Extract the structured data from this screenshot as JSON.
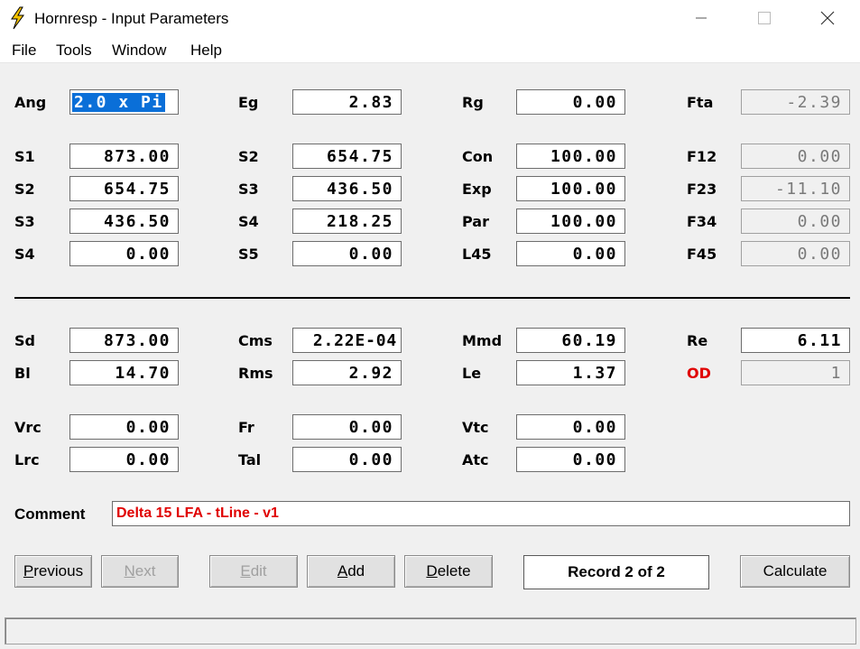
{
  "window": {
    "title": "Hornresp - Input Parameters"
  },
  "menu": [
    "File",
    "Tools",
    "Window",
    "Help"
  ],
  "params": {
    "row1": [
      {
        "label": "Ang",
        "value": "2.0 x Pi"
      },
      {
        "label": "Eg",
        "value": "2.83"
      },
      {
        "label": "Rg",
        "value": "0.00"
      },
      {
        "label": "Fta",
        "value": "-2.39"
      }
    ],
    "row2": [
      {
        "label": "S1",
        "value": "873.00"
      },
      {
        "label": "S2",
        "value": "654.75"
      },
      {
        "label": "Con",
        "value": "100.00"
      },
      {
        "label": "F12",
        "value": "0.00"
      }
    ],
    "row3": [
      {
        "label": "S2",
        "value": "654.75"
      },
      {
        "label": "S3",
        "value": "436.50"
      },
      {
        "label": "Exp",
        "value": "100.00"
      },
      {
        "label": "F23",
        "value": "-11.10"
      }
    ],
    "row4": [
      {
        "label": "S3",
        "value": "436.50"
      },
      {
        "label": "S4",
        "value": "218.25"
      },
      {
        "label": "Par",
        "value": "100.00"
      },
      {
        "label": "F34",
        "value": "0.00"
      }
    ],
    "row5": [
      {
        "label": "S4",
        "value": "0.00"
      },
      {
        "label": "S5",
        "value": "0.00"
      },
      {
        "label": "L45",
        "value": "0.00"
      },
      {
        "label": "F45",
        "value": "0.00"
      }
    ]
  },
  "driver": {
    "row1": [
      {
        "label": "Sd",
        "value": "873.00"
      },
      {
        "label": "Cms",
        "value": "2.22E-04"
      },
      {
        "label": "Mmd",
        "value": "60.19"
      },
      {
        "label": "Re",
        "value": "6.11"
      }
    ],
    "row2": [
      {
        "label": "Bl",
        "value": "14.70"
      },
      {
        "label": "Rms",
        "value": "2.92"
      },
      {
        "label": "Le",
        "value": "1.37"
      },
      {
        "label": "OD",
        "value": "1"
      }
    ],
    "row3": [
      {
        "label": "Vrc",
        "value": "0.00"
      },
      {
        "label": "Fr",
        "value": "0.00"
      },
      {
        "label": "Vtc",
        "value": "0.00"
      }
    ],
    "row4": [
      {
        "label": "Lrc",
        "value": "0.00"
      },
      {
        "label": "Tal",
        "value": "0.00"
      },
      {
        "label": "Atc",
        "value": "0.00"
      }
    ]
  },
  "comment": {
    "label": "Comment",
    "value": "Delta 15 LFA - tLine - v1"
  },
  "buttons": {
    "previous": {
      "accel": "P",
      "rest": "revious"
    },
    "next": {
      "accel": "N",
      "rest": "ext"
    },
    "edit": {
      "accel": "E",
      "rest": "dit"
    },
    "add": {
      "accel": "A",
      "rest": "dd"
    },
    "delete": {
      "accel": "D",
      "rest": "elete"
    },
    "calculate": "Calculate"
  },
  "record": "Record 2 of 2",
  "colors": {
    "highlight": "#0a6fd8",
    "warning_label": "#e00000",
    "comment_text": "#e00000",
    "app_icon": "#f5c400"
  }
}
